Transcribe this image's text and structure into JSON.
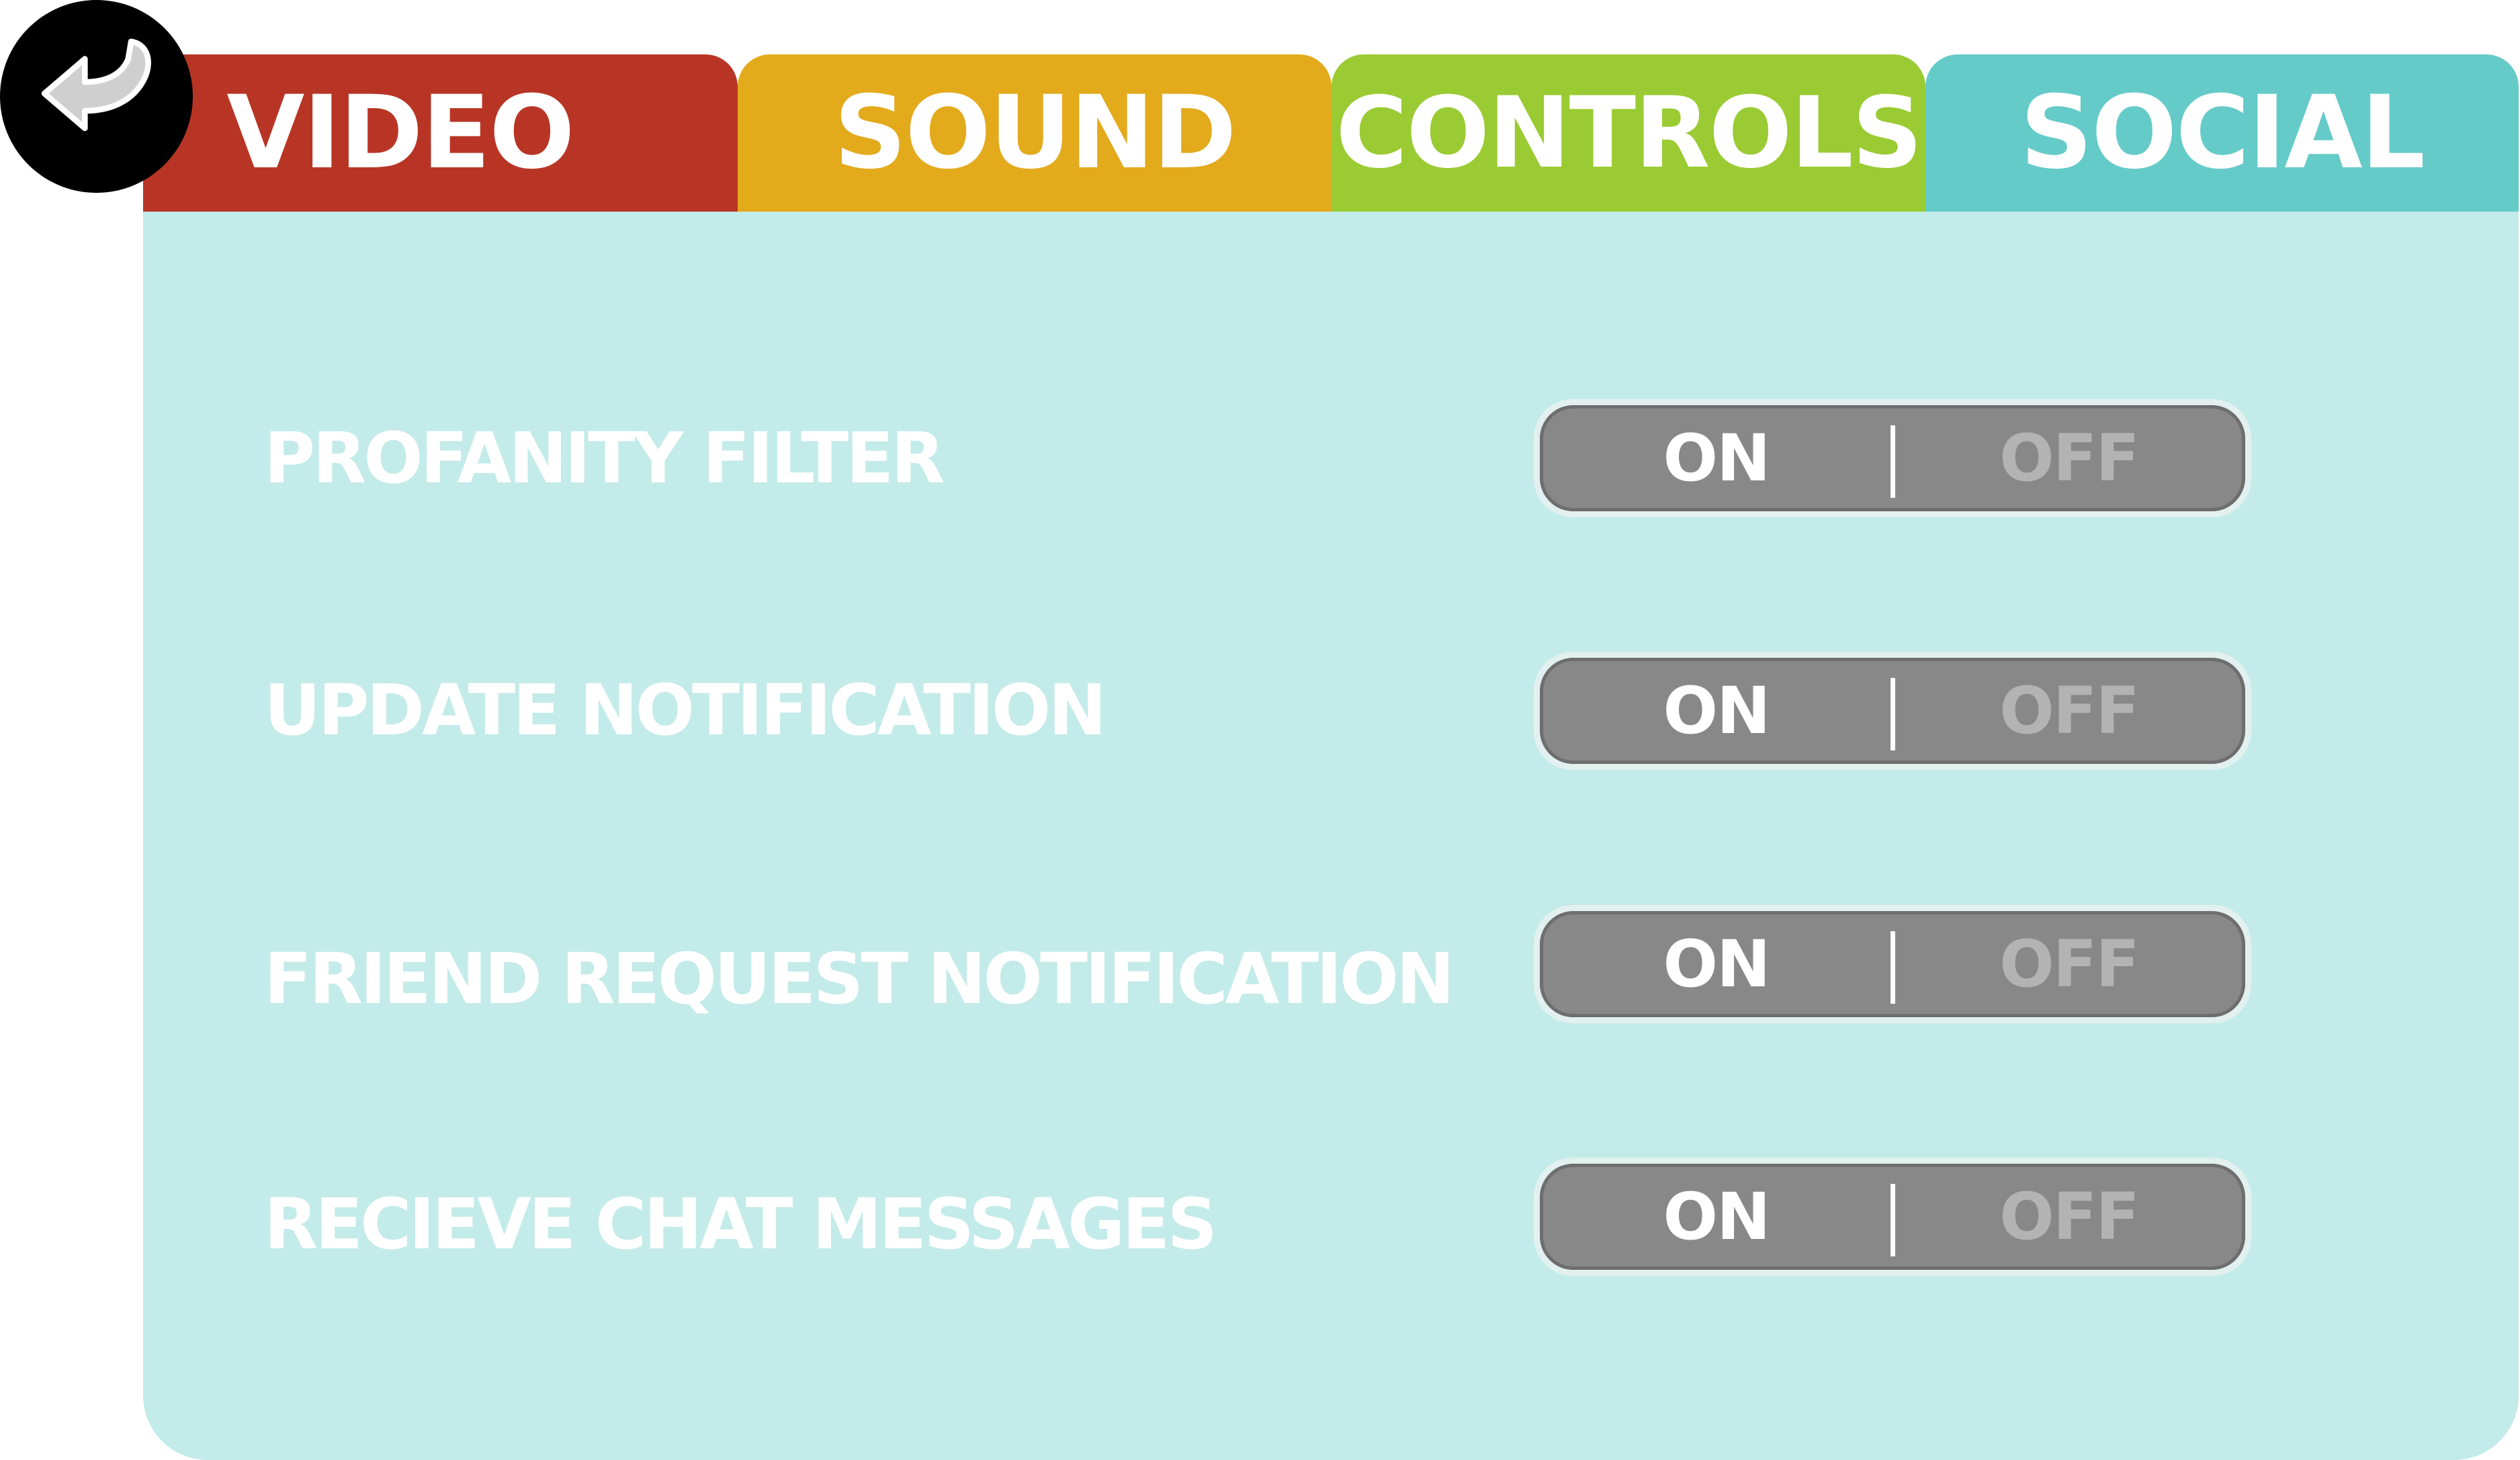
{
  "back_button": {
    "icon": "back-arrow-icon"
  },
  "tabs": [
    {
      "label": "VIDEO",
      "color": "#b83526"
    },
    {
      "label": "SOUND",
      "color": "#e3aa1c"
    },
    {
      "label": "CONTROLS",
      "color": "#9acb33"
    },
    {
      "label": "SOCIAL",
      "color": "#65cbc9"
    }
  ],
  "active_tab": "SOCIAL",
  "settings": [
    {
      "label": "PROFANITY FILTER",
      "on": "ON",
      "off": "OFF",
      "value": "ON"
    },
    {
      "label": "UPDATE NOTIFICATION",
      "on": "ON",
      "off": "OFF",
      "value": "ON"
    },
    {
      "label": "FRIEND REQUEST NOTIFICATION",
      "on": "ON",
      "off": "OFF",
      "value": "ON"
    },
    {
      "label": "RECIEVE CHAT MESSAGES",
      "on": "ON",
      "off": "OFF",
      "value": "ON"
    }
  ],
  "colors": {
    "panel": "#c3ebe9",
    "toggle": "#888888",
    "selected_text": "#ffffff",
    "unselected_text": "#b3b3b3"
  }
}
